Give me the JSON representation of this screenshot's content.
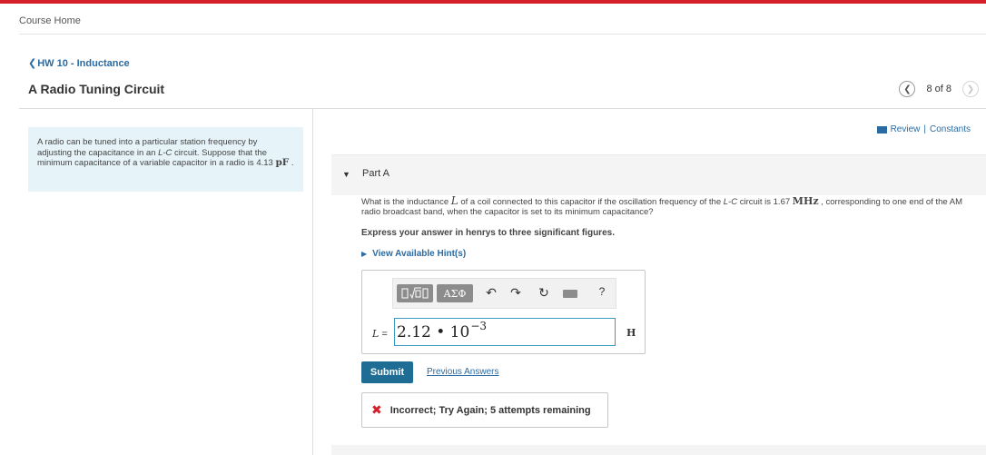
{
  "header": {
    "course_home": "Course Home",
    "back_link": "HW 10 - Inductance",
    "title": "A Radio Tuning Circuit",
    "pager": {
      "count": "8 of 8"
    }
  },
  "problem": {
    "text_1": "A radio can be tuned into a particular station frequency by adjusting the capacitance in an ",
    "circuit": "L-C",
    "text_2": " circuit. Suppose that the minimum capacitance of a variable capacitor in a radio is ",
    "value": "4.13",
    "unit": "pF",
    "text_end": " ."
  },
  "links": {
    "review": "Review",
    "separator": "|",
    "constants": "Constants"
  },
  "part": {
    "label": "Part A",
    "question_1": "What is the inductance ",
    "q_symbol": "L",
    "question_2": " of a coil connected to this capacitor if the oscillation frequency of the ",
    "q_circuit": "L-C",
    "question_3": " circuit is 1.67 ",
    "q_unit": "MHz",
    "question_4": " , corresponding to one end of the AM radio broadcast band, when the capacitor is set to its minimum capacitance?",
    "express": "Express your answer in henrys to three significant figures.",
    "hints": "View Available Hint(s)"
  },
  "answer": {
    "toolbar": {
      "greek": "ΑΣΦ",
      "help": "?"
    },
    "label_symbol": "L",
    "label_eq": " =",
    "value_base": "2.12 • 10",
    "value_exp": "−3",
    "unit": "H"
  },
  "actions": {
    "submit": "Submit",
    "previous_answers": "Previous Answers"
  },
  "feedback": {
    "message": "Incorrect; Try Again; 5 attempts remaining"
  },
  "colors": {
    "brand_red": "#d5202a",
    "link_blue": "#2a6ba3",
    "submit_blue": "#1f6c94",
    "problem_bg": "#e6f4fa"
  }
}
